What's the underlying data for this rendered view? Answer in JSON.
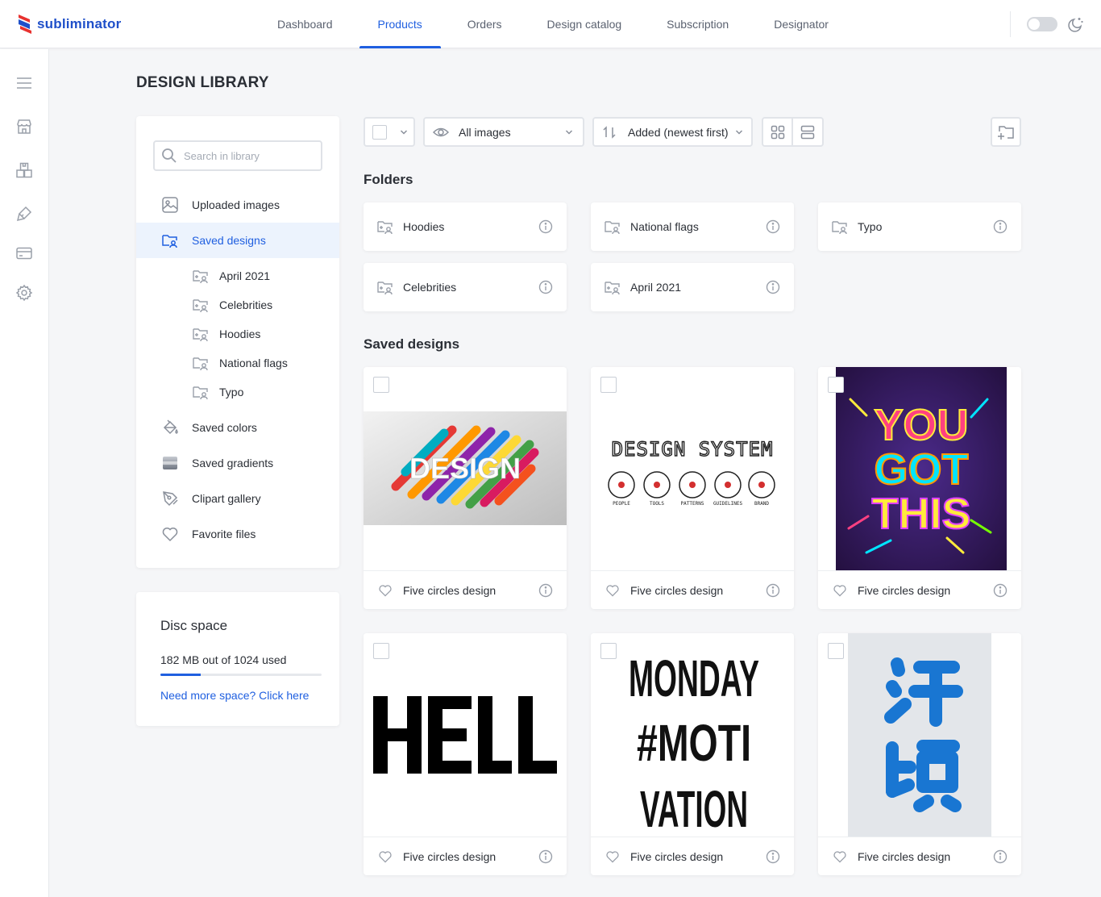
{
  "brand": {
    "name": "subliminator"
  },
  "nav": [
    {
      "label": "Dashboard",
      "active": false
    },
    {
      "label": "Products",
      "active": true
    },
    {
      "label": "Orders",
      "active": false
    },
    {
      "label": "Design catalog",
      "active": false
    },
    {
      "label": "Subscription",
      "active": false
    },
    {
      "label": "Designator",
      "active": false
    }
  ],
  "page": {
    "title": "DESIGN LIBRARY"
  },
  "library": {
    "search_placeholder": "Search in library",
    "items": [
      {
        "label": "Uploaded images",
        "icon": "image-icon"
      },
      {
        "label": "Saved designs",
        "icon": "user-folder-icon",
        "active": true
      },
      {
        "label": "Saved colors",
        "icon": "paint-bucket-icon"
      },
      {
        "label": "Saved gradients",
        "icon": "gradient-icon"
      },
      {
        "label": "Clipart gallery",
        "icon": "pen-nib-icon"
      },
      {
        "label": "Favorite files",
        "icon": "heart-icon"
      }
    ],
    "subfolders": [
      {
        "label": "April 2021"
      },
      {
        "label": "Celebrities"
      },
      {
        "label": "Hoodies"
      },
      {
        "label": "National flags"
      },
      {
        "label": "Typo"
      }
    ]
  },
  "disc": {
    "title": "Disc space",
    "used_text": "182 MB out of 1024 used",
    "used_fraction": 0.25,
    "link": "Need more space? Click here"
  },
  "toolbar": {
    "filter_label": "All images",
    "sort_label": "Added (newest first)"
  },
  "folders": {
    "title": "Folders",
    "items": [
      {
        "label": "Hoodies"
      },
      {
        "label": "National flags"
      },
      {
        "label": "Typo"
      },
      {
        "label": "Celebrities"
      },
      {
        "label": "April 2021"
      }
    ]
  },
  "designs": {
    "title": "Saved designs",
    "items": [
      {
        "label": "Five circles design",
        "art": "DESIGN"
      },
      {
        "label": "Five circles design",
        "art": "DESIGN SYSTEM",
        "sub": [
          "PEOPLE",
          "TOOLS",
          "PATTERNS",
          "GUIDELINES",
          "BRAND"
        ]
      },
      {
        "label": "Five circles design",
        "art": "YOU GOT THIS"
      },
      {
        "label": "Five circles design",
        "art": "HELL"
      },
      {
        "label": "Five circles design",
        "art": "MONDAY #MOTI VATION"
      },
      {
        "label": "Five circles design",
        "art": "汗顔"
      }
    ]
  },
  "colors": {
    "accent": "#1f5fe0",
    "brand_red": "#e8322f",
    "brand_blue": "#1f4fc9"
  }
}
